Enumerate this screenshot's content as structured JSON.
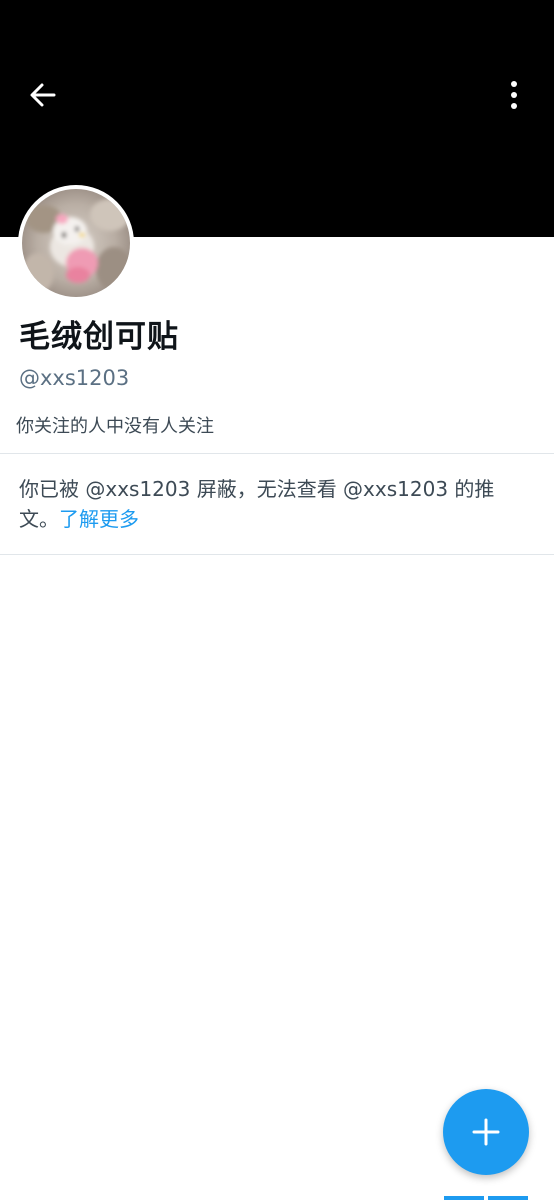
{
  "header": {
    "back_icon": "arrow-left-icon",
    "more_icon": "more-vertical-icon",
    "banner_color": "#000000"
  },
  "profile": {
    "display_name": "毛绒创可贴",
    "handle": "@xxs1203",
    "followers_you_know": "你关注的人中没有人关注"
  },
  "blocked_notice": {
    "text": "你已被 @xxs1203 屏蔽，无法查看 @xxs1203 的推文。",
    "link_text": "了解更多"
  },
  "fab": {
    "icon": "plus-icon",
    "color": "#1d9bf0"
  }
}
